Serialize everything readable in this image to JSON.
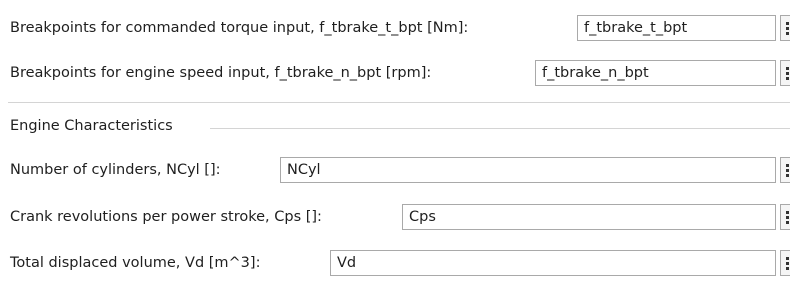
{
  "params": [
    {
      "label": "Breakpoints for commanded torque input, f_tbrake_t_bpt [Nm]:",
      "value": "f_tbrake_t_bpt"
    },
    {
      "label": "Breakpoints for engine speed input, f_tbrake_n_bpt [rpm]:",
      "value": "f_tbrake_n_bpt"
    }
  ],
  "group": {
    "title": "Engine Characteristics",
    "params": [
      {
        "label": "Number of cylinders, NCyl []:",
        "value": "NCyl"
      },
      {
        "label": "Crank revolutions per power stroke, Cps []:",
        "value": "Cps"
      },
      {
        "label": "Total displaced volume, Vd [m^3]:",
        "value": "Vd"
      }
    ]
  }
}
